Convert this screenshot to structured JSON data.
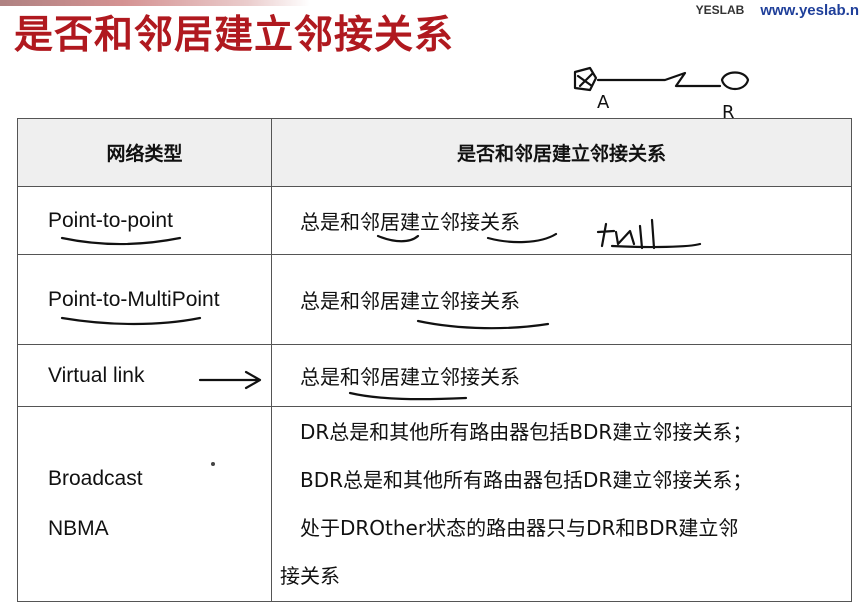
{
  "slide": {
    "title": "是否和邻居建立邻接关系",
    "brand_small": "YESLAB",
    "brand_url": "www.yeslab.n"
  },
  "table": {
    "headers": [
      "网络类型",
      "是否和邻居建立邻接关系"
    ],
    "rows": [
      {
        "type": [
          "Point-to-point"
        ],
        "relation": [
          "总是和邻居建立邻接关系"
        ]
      },
      {
        "type": [
          "Point-to-MultiPoint"
        ],
        "relation": [
          "总是和邻居建立邻接关系"
        ]
      },
      {
        "type": [
          "Virtual link"
        ],
        "relation": [
          "总是和邻居建立邻接关系"
        ]
      },
      {
        "type": [
          "Broadcast",
          "NBMA"
        ],
        "relation": [
          "DR总是和其他所有路由器包括BDR建立邻接关系；",
          "BDR总是和其他所有路由器包括DR建立邻接关系；",
          "处于DROther状态的路由器只与DR和BDR建立邻",
          "接关系"
        ]
      }
    ]
  },
  "annotations": {
    "label_a": "A",
    "label_b": "R",
    "full_note": "full"
  }
}
